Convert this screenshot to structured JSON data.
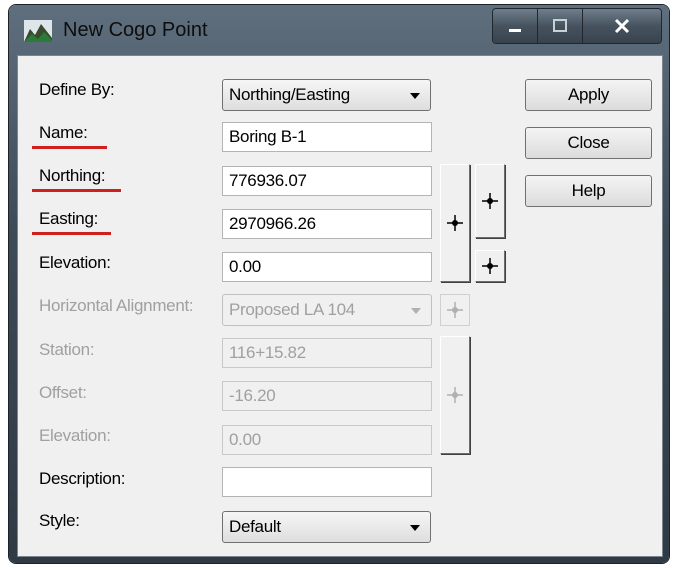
{
  "window": {
    "title": "New Cogo Point",
    "controls": {
      "minimize": "–",
      "maximize": "□",
      "close": "✕"
    },
    "app_icon": "terrain-app-icon"
  },
  "form": {
    "define_by": {
      "label": "Define By:",
      "value": "Northing/Easting"
    },
    "name": {
      "label": "Name:",
      "value": "Boring B-1"
    },
    "northing": {
      "label": "Northing:",
      "value": "776936.07"
    },
    "easting": {
      "label": "Easting:",
      "value": "2970966.26"
    },
    "elevation": {
      "label": "Elevation:",
      "value": "0.00"
    },
    "horizontal_alignment": {
      "label": "Horizontal Alignment:",
      "value": "Proposed LA 104"
    },
    "station": {
      "label": "Station:",
      "value": "116+15.82"
    },
    "offset": {
      "label": "Offset:",
      "value": "-16.20"
    },
    "alignment_elevation": {
      "label": "Elevation:",
      "value": "0.00"
    },
    "description": {
      "label": "Description:",
      "value": ""
    },
    "style": {
      "label": "Style:",
      "value": "Default"
    }
  },
  "buttons": {
    "apply": "Apply",
    "close": "Close",
    "help": "Help"
  },
  "icons": {
    "picker": "crosshair-icon"
  },
  "colors": {
    "title_bar": "#3d4a57",
    "dialog_bg": "#f0f0f0",
    "annotation_underline": "#d01f1f",
    "disabled_text": "#a0a0a0"
  }
}
